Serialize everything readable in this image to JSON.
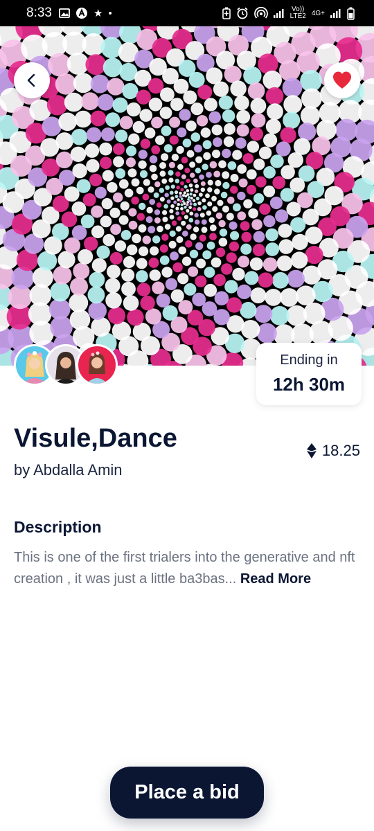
{
  "status_bar": {
    "time": "8:33",
    "left_icons": [
      "image-icon",
      "a-logo-icon",
      "star-icon",
      "dot-icon"
    ],
    "right_icons": [
      "battery-saver-icon",
      "alarm-icon",
      "hotspot-icon",
      "signal-icon",
      "signal-icon",
      "battery-icon"
    ],
    "network_label_1": "Vo))",
    "network_label_2": "LTE2",
    "network_label_3": "4G+"
  },
  "nav": {
    "back_icon": "chevron-left-icon",
    "favorite_icon": "heart-icon"
  },
  "colors": {
    "primary": "#0b1633",
    "muted_text": "#6b7280",
    "favorite": "#e8283b",
    "art_magenta": "#e62d8e",
    "art_cyan": "#b9f4f4",
    "art_lavender": "#c9a3ee",
    "art_white": "#ffffff"
  },
  "auction": {
    "ending_label": "Ending in",
    "ending_time": "12h 30m"
  },
  "item": {
    "title": "Visule,Dance",
    "author": "by Abdalla Amin",
    "price": "18.25",
    "currency_icon": "ethereum-icon"
  },
  "description": {
    "heading": "Description",
    "text": "This is one of the first trialers into the generative and nft creation , it was just a little ba3bas... ",
    "read_more": "Read More"
  },
  "cta": {
    "label": "Place a bid"
  }
}
